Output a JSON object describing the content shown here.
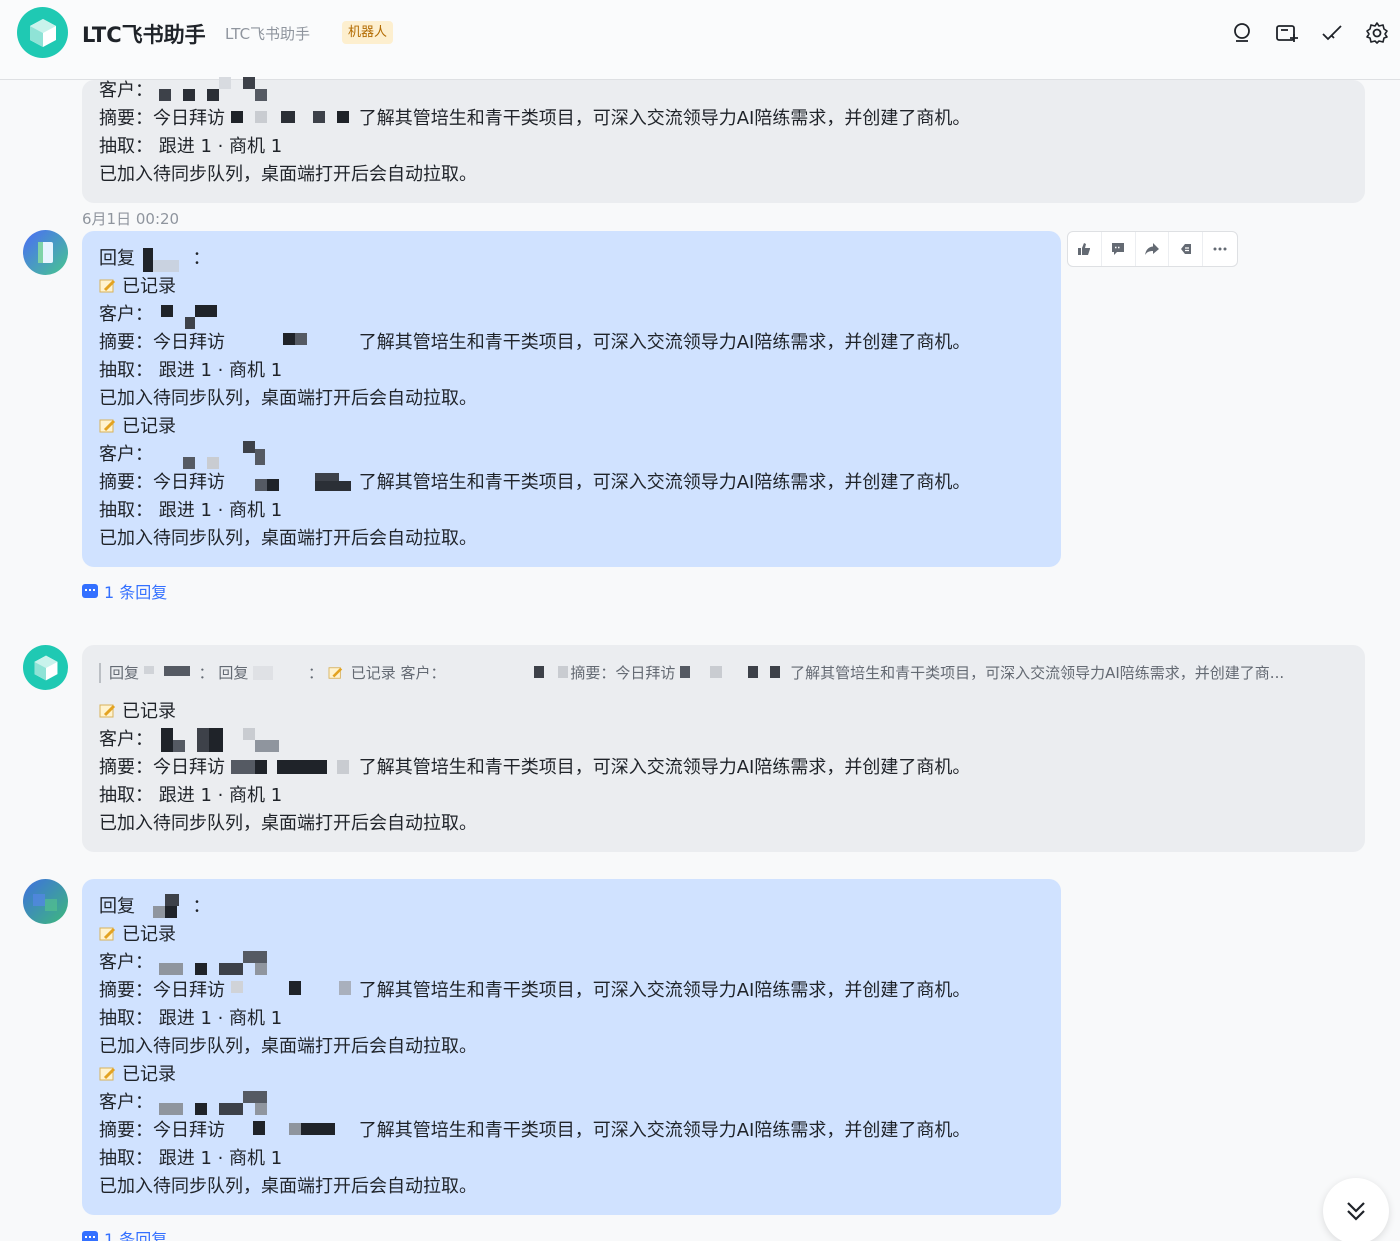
{
  "header": {
    "title": "LTC飞书助手",
    "subtitle": "LTC飞书助手",
    "badge": "机器人",
    "icons": [
      "search-icon",
      "add-tab-icon",
      "done-check-icon",
      "settings-icon"
    ]
  },
  "common": {
    "recorded": "已记录",
    "customer_label": "客户：",
    "summary_label": "摘要：",
    "summary_prefix": "今日拜访",
    "summary_suffix": "了解其管培生和青干类项目，可深入交流领导力AI陪练需求，并创建了商机。",
    "extract_line": "抽取：  跟进 1 · 商机 1",
    "queue_line": "已加入待同步队列，桌面端打开后会自动拉取。",
    "reply_prefix": "回复",
    "colon": "："
  },
  "timestamp": "6月1日 00:20",
  "reply_count_label": "1 条回复",
  "toolbar": {
    "icons": [
      "thumbs-up-icon",
      "comment-icon",
      "forward-icon",
      "pin-icon",
      "more-icon"
    ]
  },
  "quote": {
    "reply1": "回复",
    "reply2": "回复",
    "colon": "：",
    "recorded_customer": "已记录 客户：",
    "summary_start": "摘要：今日拜访",
    "summary_end": "了解其管培生和青干类项目，可深入交流领导力AI陪练需求，并创建了商..."
  },
  "colors": {
    "accent": "#3370ff",
    "bot_green": "#1fc9b3",
    "bubble_blue": "#d0e2ff",
    "bubble_gray": "#ebedf0",
    "badge_bg": "#fdefcf"
  }
}
